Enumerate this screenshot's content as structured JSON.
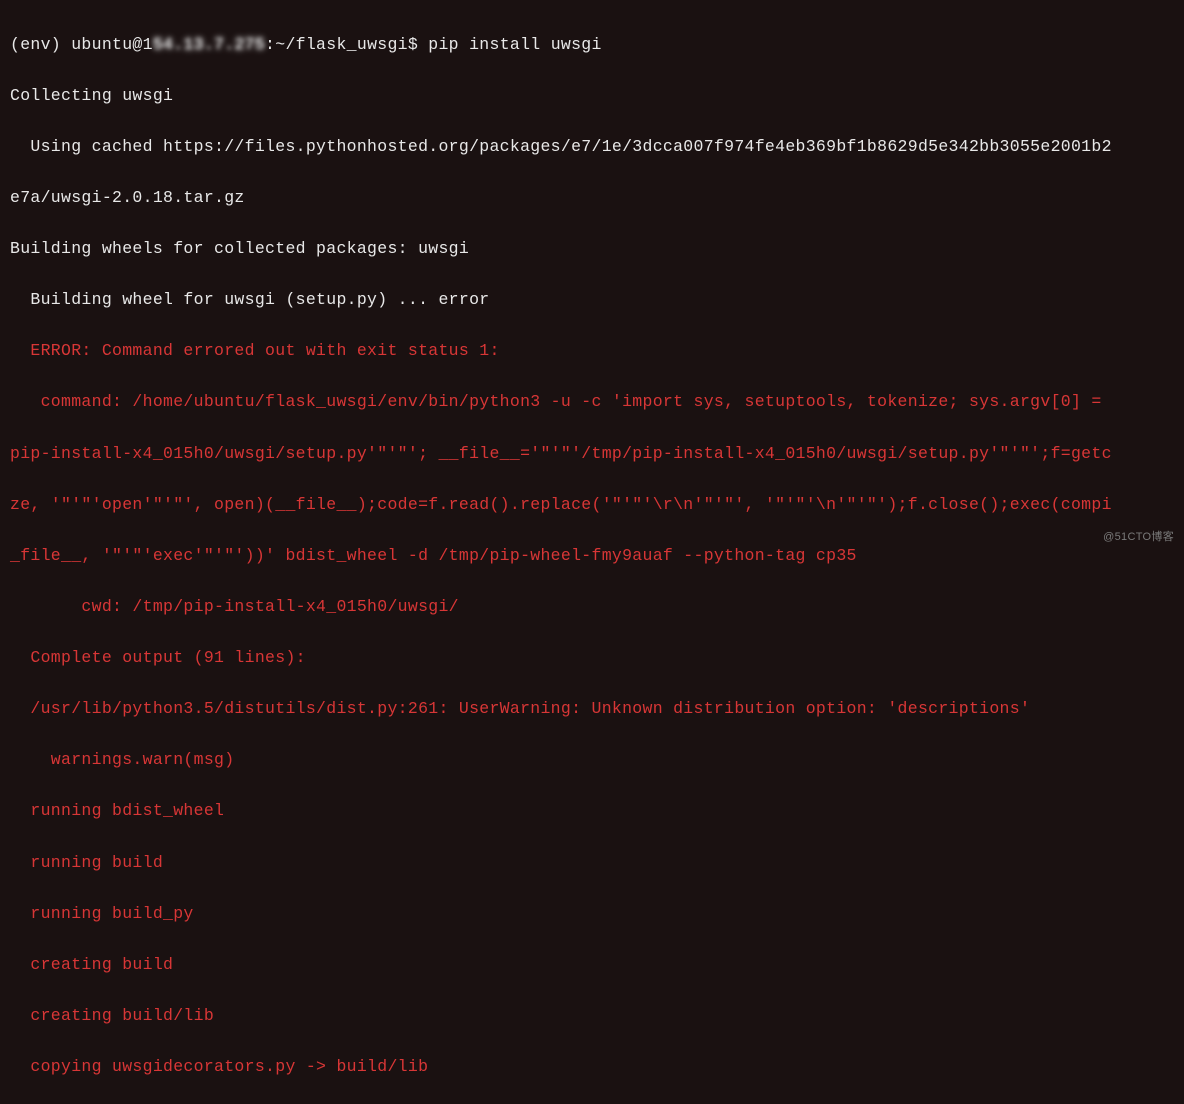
{
  "terminal": {
    "prompt_prefix": "(env) ubuntu@1",
    "prompt_blurred": "54.13.7.275",
    "prompt_suffix": ":~/flask_uwsgi$ ",
    "command": "pip install uwsgi",
    "lines": {
      "collecting": "Collecting uwsgi",
      "using_cached": "  Using cached https://files.pythonhosted.org/packages/e7/1e/3dcca007f974fe4eb369bf1b8629d5e342bb3055e2001b2",
      "tarball": "e7a/uwsgi-2.0.18.tar.gz",
      "building_wheels": "Building wheels for collected packages: uwsgi",
      "building_wheel": "  Building wheel for uwsgi (setup.py) ... error",
      "error_header": "  ERROR: Command errored out with exit status 1:",
      "command_line": "   command: /home/ubuntu/flask_uwsgi/env/bin/python3 -u -c 'import sys, setuptools, tokenize; sys.argv[0] =",
      "pip_install_line": "pip-install-x4_015h0/uwsgi/setup.py'\"'\"'; __file__='\"'\"'/tmp/pip-install-x4_015h0/uwsgi/setup.py'\"'\"';f=getc",
      "ze_line": "ze, '\"'\"'open'\"'\"', open)(__file__);code=f.read().replace('\"'\"'\\r\\n'\"'\"', '\"'\"'\\n'\"'\"');f.close();exec(compi",
      "file_line": "_file__, '\"'\"'exec'\"'\"'))' bdist_wheel -d /tmp/pip-wheel-fmy9auaf --python-tag cp35",
      "cwd": "       cwd: /tmp/pip-install-x4_015h0/uwsgi/",
      "complete_output": "  Complete output (91 lines):",
      "userwarning": "  /usr/lib/python3.5/distutils/dist.py:261: UserWarning: Unknown distribution option: 'descriptions'",
      "warnings": "    warnings.warn(msg)",
      "running_bdist": "  running bdist_wheel",
      "running_build": "  running build",
      "running_build_py": "  running build_py",
      "creating_build": "  creating build",
      "creating_build_lib": "  creating build/lib",
      "copying": "  copying uwsgidecorators.py -> build/lib"
    }
  },
  "watermark": "@51CTO博客"
}
